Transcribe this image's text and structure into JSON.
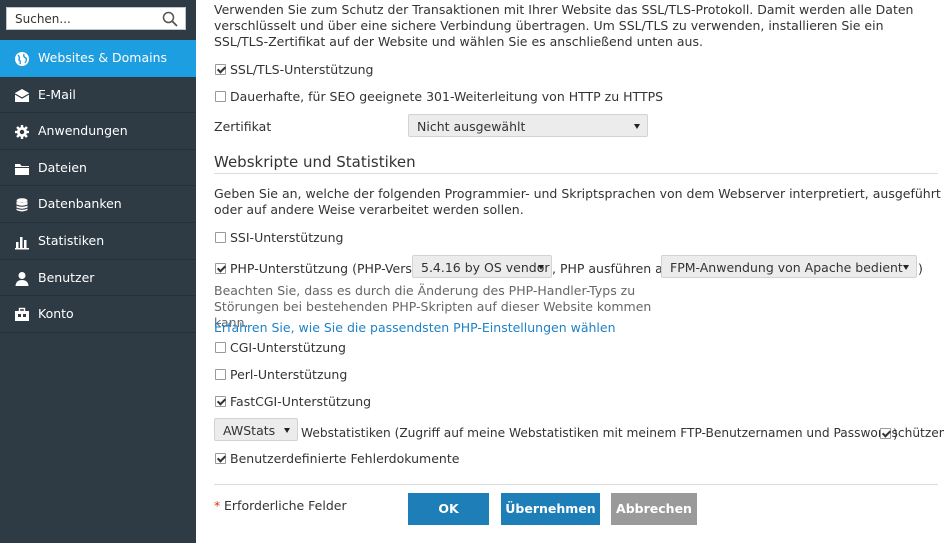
{
  "sidebar": {
    "search_placeholder": "Suchen...",
    "items": [
      {
        "label": "Websites & Domains",
        "icon": "globe-icon",
        "active": true
      },
      {
        "label": "E-Mail",
        "icon": "envelope-icon"
      },
      {
        "label": "Anwendungen",
        "icon": "gear-icon"
      },
      {
        "label": "Dateien",
        "icon": "folder-icon"
      },
      {
        "label": "Datenbanken",
        "icon": "database-icon"
      },
      {
        "label": "Statistiken",
        "icon": "bar-chart-icon"
      },
      {
        "label": "Benutzer",
        "icon": "user-icon"
      },
      {
        "label": "Konto",
        "icon": "briefcase-icon"
      }
    ],
    "colors": {
      "background": "#2e3a44",
      "active": "#1d9ee0"
    }
  },
  "ssl": {
    "intro": "Verwenden Sie zum Schutz der Transaktionen mit Ihrer Website das SSL/TLS-Protokoll. Damit werden alle Daten verschlüsselt und über eine sichere Verbindung übertragen. Um SSL/TLS zu verwenden, installieren Sie ein SSL/TLS-Zertifikat auf der Website und wählen Sie es anschließend unten aus.",
    "ssl_support_label": "SSL/TLS-Unterstützung",
    "ssl_support_checked": true,
    "redirect_label": "Dauerhafte, für SEO geeignete 301-Weiterleitung von HTTP zu HTTPS",
    "redirect_checked": false,
    "certificate_label": "Zertifikat",
    "certificate_value": "Nicht ausgewählt"
  },
  "scripting": {
    "title": "Webskripte und Statistiken",
    "intro": "Geben Sie an, welche der folgenden Programmier- und Skriptsprachen von dem Webserver interpretiert, ausgeführt oder auf andere Weise verarbeitet werden sollen.",
    "ssi_label": "SSI-Unterstützung",
    "ssi_checked": false,
    "php_label": "PHP-Unterstützung (PHP-Version",
    "php_checked": true,
    "php_version": "5.4.16 by OS vendor",
    "php_run_as_label": ", PHP ausführen als",
    "php_handler": "FPM-Anwendung von Apache bedient",
    "php_close": ")",
    "php_note": "Beachten Sie, dass es durch die Änderung des PHP-Handler-Typs zu Störungen bei bestehenden PHP-Skripten auf dieser Website kommen kann.",
    "php_link": "Erfahren Sie, wie Sie die passendsten PHP-Einstellungen wählen",
    "cgi_label": "CGI-Unterstützung",
    "cgi_checked": false,
    "perl_label": "Perl-Unterstützung",
    "perl_checked": false,
    "fastcgi_label": "FastCGI-Unterstützung",
    "fastcgi_checked": true,
    "stats_engine": "AWStats",
    "stats_label": "Webstatistiken (Zugriff auf meine Webstatistiken mit meinem FTP-Benutzernamen und Passwort schützen",
    "stats_protect_checked": true,
    "stats_close": ")",
    "error_docs_label": "Benutzerdefinierte Fehlerdokumente",
    "error_docs_checked": true
  },
  "footer": {
    "required_star": "*",
    "required_label": "Erforderliche Felder",
    "ok_label": "OK",
    "apply_label": "Übernehmen",
    "cancel_label": "Abbrechen",
    "colors": {
      "primary": "#1e7fb8",
      "secondary": "#9a9a9a"
    }
  }
}
